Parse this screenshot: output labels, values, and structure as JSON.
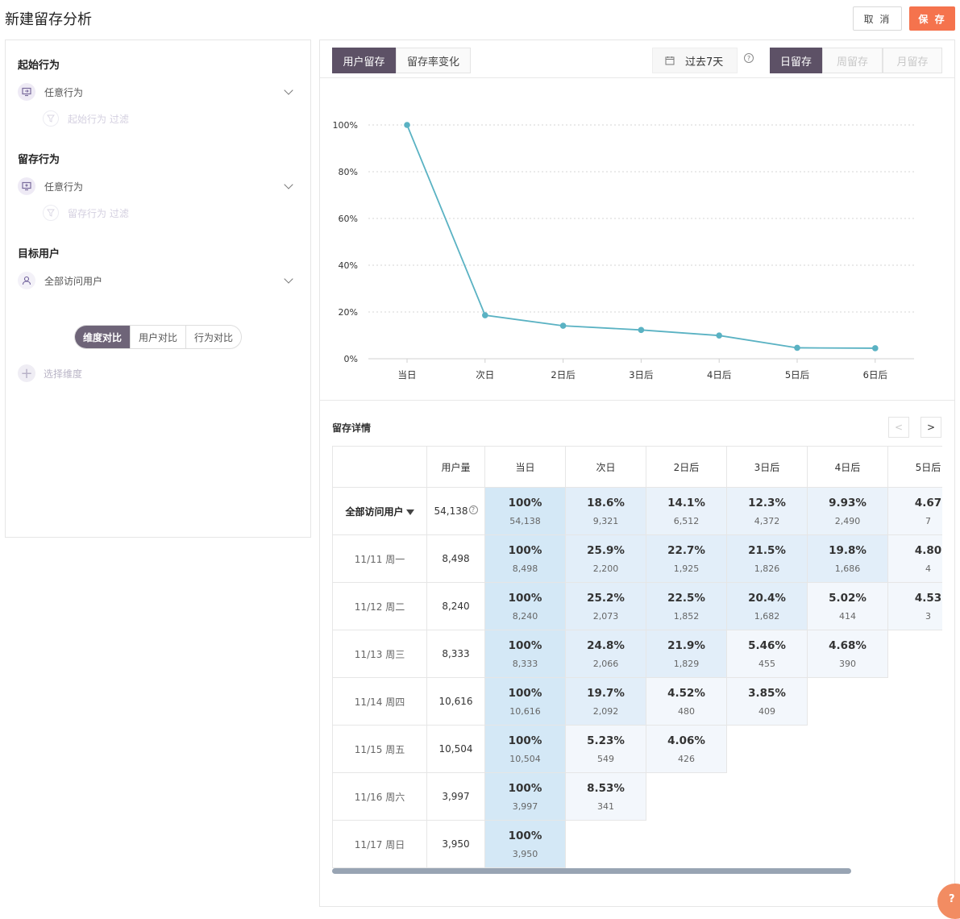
{
  "header": {
    "title": "新建留存分析",
    "cancel": "取 消",
    "save": "保 存"
  },
  "left": {
    "start_title": "起始行为",
    "start_select": "任意行为",
    "start_filter": "起始行为 过滤",
    "retain_title": "留存行为",
    "retain_select": "任意行为",
    "retain_filter": "留存行为 过滤",
    "target_title": "目标用户",
    "target_select": "全部访问用户",
    "compare_tabs": [
      "维度对比",
      "用户对比",
      "行为对比"
    ],
    "add_dimension": "选择维度"
  },
  "right": {
    "view_tabs": [
      "用户留存",
      "留存率变化"
    ],
    "date_range": "过去7天",
    "period_tabs": [
      "日留存",
      "周留存",
      "月留存"
    ],
    "detail_title": "留存详情",
    "pager_prev": "<",
    "pager_next": ">"
  },
  "chart_data": {
    "type": "line",
    "x": [
      "当日",
      "次日",
      "2日后",
      "3日后",
      "4日后",
      "5日后",
      "6日后"
    ],
    "values": [
      100,
      18.6,
      14.1,
      12.3,
      9.93,
      4.67,
      4.5
    ],
    "y_ticks": [
      "0%",
      "20%",
      "40%",
      "60%",
      "80%",
      "100%"
    ],
    "ylim": [
      0,
      100
    ],
    "grid": true,
    "color": "#5ab2c3"
  },
  "table": {
    "columns": [
      "用户量",
      "当日",
      "次日",
      "2日后",
      "3日后",
      "4日后",
      "5日后"
    ],
    "rows": [
      {
        "label": "全部访问用户",
        "count": "54,138",
        "cells": [
          [
            "100%",
            "54,138"
          ],
          [
            "18.6%",
            "9,321"
          ],
          [
            "14.1%",
            "6,512"
          ],
          [
            "12.3%",
            "4,372"
          ],
          [
            "9.93%",
            "2,490"
          ],
          [
            "4.67",
            "7"
          ]
        ]
      },
      {
        "label": "11/11 周一",
        "count": "8,498",
        "cells": [
          [
            "100%",
            "8,498"
          ],
          [
            "25.9%",
            "2,200"
          ],
          [
            "22.7%",
            "1,925"
          ],
          [
            "21.5%",
            "1,826"
          ],
          [
            "19.8%",
            "1,686"
          ],
          [
            "4.80",
            "4"
          ]
        ]
      },
      {
        "label": "11/12 周二",
        "count": "8,240",
        "cells": [
          [
            "100%",
            "8,240"
          ],
          [
            "25.2%",
            "2,073"
          ],
          [
            "22.5%",
            "1,852"
          ],
          [
            "20.4%",
            "1,682"
          ],
          [
            "5.02%",
            "414"
          ],
          [
            "4.53",
            "3"
          ]
        ]
      },
      {
        "label": "11/13 周三",
        "count": "8,333",
        "cells": [
          [
            "100%",
            "8,333"
          ],
          [
            "24.8%",
            "2,066"
          ],
          [
            "21.9%",
            "1,829"
          ],
          [
            "5.46%",
            "455"
          ],
          [
            "4.68%",
            "390"
          ]
        ]
      },
      {
        "label": "11/14 周四",
        "count": "10,616",
        "cells": [
          [
            "100%",
            "10,616"
          ],
          [
            "19.7%",
            "2,092"
          ],
          [
            "4.52%",
            "480"
          ],
          [
            "3.85%",
            "409"
          ]
        ]
      },
      {
        "label": "11/15 周五",
        "count": "10,504",
        "cells": [
          [
            "100%",
            "10,504"
          ],
          [
            "5.23%",
            "549"
          ],
          [
            "4.06%",
            "426"
          ]
        ]
      },
      {
        "label": "11/16 周六",
        "count": "3,997",
        "cells": [
          [
            "100%",
            "3,997"
          ],
          [
            "8.53%",
            "341"
          ]
        ]
      },
      {
        "label": "11/17 周日",
        "count": "3,950",
        "cells": [
          [
            "100%",
            "3,950"
          ]
        ]
      }
    ]
  },
  "help_button": "?"
}
